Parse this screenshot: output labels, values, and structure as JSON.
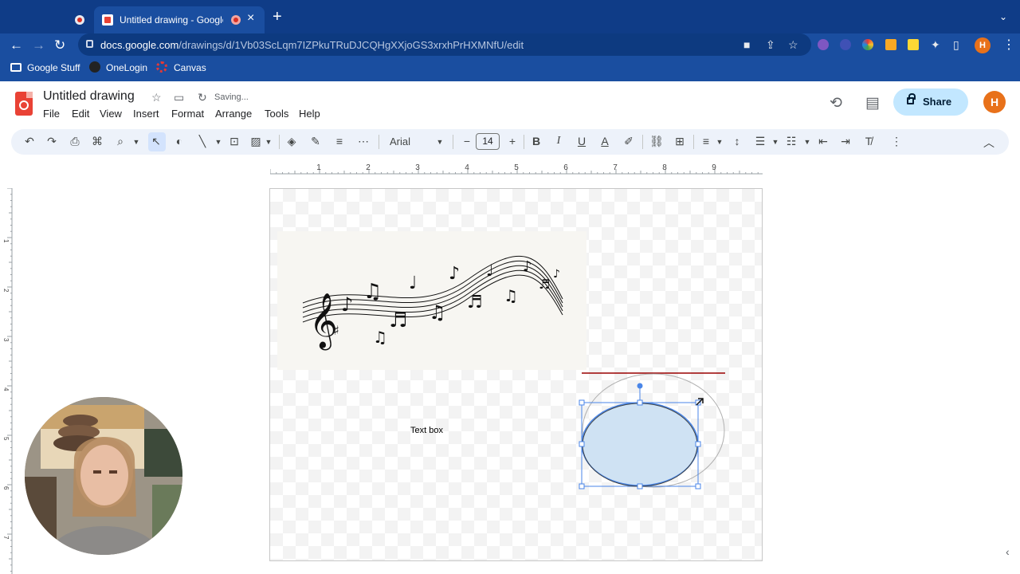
{
  "browser": {
    "active_tab_title": "Untitled drawing - Google Drawings",
    "url_host": "docs.google.com",
    "url_path": "/drawings/d/1Vb03ScLqm7IZPkuTRuDJCQHgXXjoGS3xrxhPrHXMNfU/edit",
    "profile_initial": "H",
    "bookmarks": [
      "Google Stuff",
      "OneLogin",
      "Canvas"
    ]
  },
  "app": {
    "doc_title": "Untitled drawing",
    "saving_status": "Saving...",
    "menus": [
      "File",
      "Edit",
      "View",
      "Insert",
      "Format",
      "Arrange",
      "Tools",
      "Help"
    ],
    "share_label": "Share",
    "user_initial": "H"
  },
  "toolbar": {
    "font_name": "Arial",
    "font_size": "14"
  },
  "ruler": {
    "h_ticks": [
      "1",
      "2",
      "3",
      "4",
      "5",
      "6",
      "7",
      "8",
      "9"
    ],
    "v_ticks": [
      "1",
      "2",
      "3",
      "4",
      "5",
      "6",
      "7"
    ]
  },
  "canvas": {
    "text_box": "Text box"
  },
  "colors": {
    "chrome": "#1a4ea0",
    "tab_strip": "#0f3c87",
    "share_bg": "#c2e7ff",
    "toolbar_bg": "#edf2fa",
    "selection": "#4a86e8",
    "ellipse_fill": "#cfe2f3",
    "line_red": "#990000",
    "avatar": "#e8711a"
  }
}
